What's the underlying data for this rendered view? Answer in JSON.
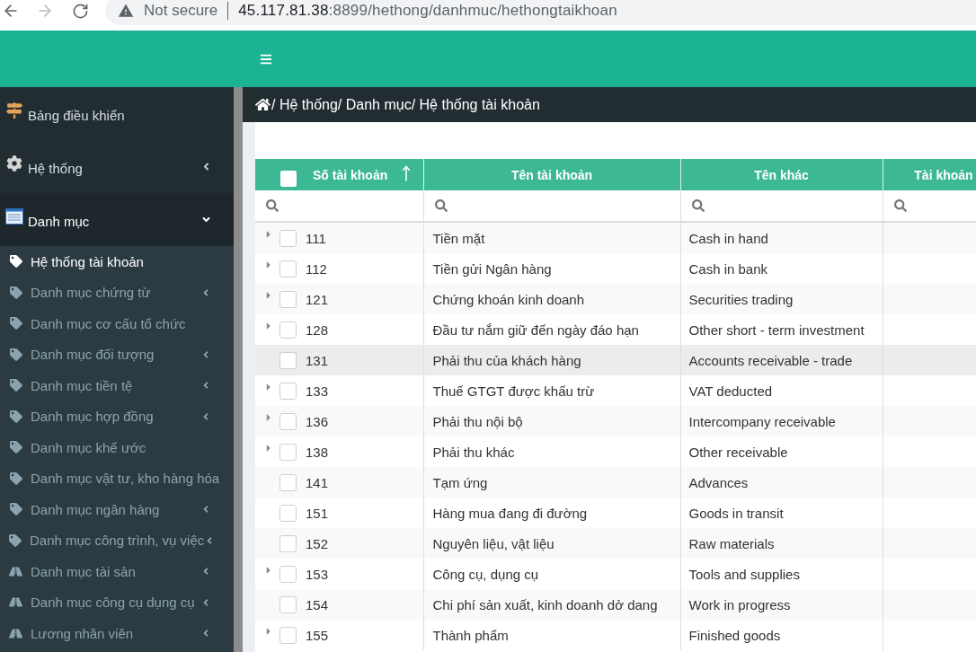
{
  "browser": {
    "security_label": "Not secure",
    "url_host": "45.117.81.38",
    "url_path": ":8899/hethong/danhmuc/hethongtaikhoan"
  },
  "sidebar": {
    "items": [
      {
        "label": "Bảng điều khiển",
        "kind": "dashboard",
        "expandable": false,
        "expanded": false
      },
      {
        "label": "Hệ thống",
        "kind": "system",
        "expandable": true,
        "expanded": false
      },
      {
        "label": "Danh mục",
        "kind": "catalog",
        "expandable": true,
        "expanded": true,
        "children": [
          {
            "label": "Hệ thống tài khoản",
            "kind": "tag",
            "expandable": false,
            "selected": true
          },
          {
            "label": "Danh mục chứng từ",
            "kind": "tag",
            "expandable": true,
            "selected": false
          },
          {
            "label": "Danh mục cơ cấu tổ chức",
            "kind": "tag",
            "expandable": false,
            "selected": false
          },
          {
            "label": "Danh mục đối tượng",
            "kind": "tag",
            "expandable": true,
            "selected": false
          },
          {
            "label": "Danh mục tiền tệ",
            "kind": "tag",
            "expandable": true,
            "selected": false
          },
          {
            "label": "Danh mục hợp đồng",
            "kind": "tag",
            "expandable": true,
            "selected": false
          },
          {
            "label": "Danh mục khế ước",
            "kind": "tag",
            "expandable": false,
            "selected": false
          },
          {
            "label": "Danh mục vật tư, kho hàng hóa",
            "kind": "tag",
            "expandable": false,
            "selected": false
          },
          {
            "label": "Danh mục ngân hàng",
            "kind": "tag",
            "expandable": true,
            "selected": false
          },
          {
            "label": "Danh mục công trình, vụ việc",
            "kind": "tag",
            "expandable": true,
            "selected": false
          },
          {
            "label": "Danh mục tài sản",
            "kind": "road",
            "expandable": true,
            "selected": false
          },
          {
            "label": "Danh mục công cụ dụng cụ",
            "kind": "road",
            "expandable": true,
            "selected": false
          },
          {
            "label": "Lương nhân viên",
            "kind": "road",
            "expandable": true,
            "selected": false
          }
        ]
      }
    ]
  },
  "breadcrumb": {
    "text": "/ Hệ thống/ Danh mục/ Hệ thống tài khoản"
  },
  "table": {
    "select_all": {
      "checked": false
    },
    "columns": [
      {
        "label": "Số tài khoản",
        "sorted": true
      },
      {
        "label": "Tên tài khoản",
        "sorted": false
      },
      {
        "label": "Tên khác",
        "sorted": false
      },
      {
        "label": "Tài khoản",
        "sorted": false
      }
    ],
    "rows": [
      {
        "account_no": "111",
        "name": "Tiền mặt",
        "other_name": "Cash in hand",
        "expandable": true,
        "checked": false,
        "highlighted": false
      },
      {
        "account_no": "112",
        "name": "Tiền gửi Ngân hàng",
        "other_name": "Cash in bank",
        "expandable": true,
        "checked": false,
        "highlighted": false
      },
      {
        "account_no": "121",
        "name": "Chứng khoán kinh doanh",
        "other_name": "Securities trading",
        "expandable": true,
        "checked": false,
        "highlighted": false
      },
      {
        "account_no": "128",
        "name": "Đầu tư nắm giữ đến ngày đáo hạn",
        "other_name": "Other short - term investment",
        "expandable": true,
        "checked": false,
        "highlighted": false
      },
      {
        "account_no": "131",
        "name": "Phải thu của khách hàng",
        "other_name": "Accounts receivable - trade",
        "expandable": false,
        "checked": false,
        "highlighted": true
      },
      {
        "account_no": "133",
        "name": "Thuế GTGT được khấu trừ",
        "other_name": "VAT deducted",
        "expandable": true,
        "checked": false,
        "highlighted": false
      },
      {
        "account_no": "136",
        "name": "Phải thu nội bộ",
        "other_name": "Intercompany receivable",
        "expandable": true,
        "checked": false,
        "highlighted": false
      },
      {
        "account_no": "138",
        "name": "Phải thu khác",
        "other_name": "Other receivable",
        "expandable": true,
        "checked": false,
        "highlighted": false
      },
      {
        "account_no": "141",
        "name": "Tạm ứng",
        "other_name": "Advances",
        "expandable": false,
        "checked": false,
        "highlighted": false
      },
      {
        "account_no": "151",
        "name": "Hàng mua đang đi đường",
        "other_name": "Goods in transit",
        "expandable": false,
        "checked": false,
        "highlighted": false
      },
      {
        "account_no": "152",
        "name": "Nguyên liệu, vật liệu",
        "other_name": "Raw materials",
        "expandable": false,
        "checked": false,
        "highlighted": false
      },
      {
        "account_no": "153",
        "name": "Công cụ, dụng cụ",
        "other_name": "Tools and supplies",
        "expandable": true,
        "checked": false,
        "highlighted": false
      },
      {
        "account_no": "154",
        "name": "Chi phí sản xuất, kinh doanh dở dang",
        "other_name": "Work in progress",
        "expandable": false,
        "checked": false,
        "highlighted": false
      },
      {
        "account_no": "155",
        "name": "Thành phẩm",
        "other_name": "Finished goods",
        "expandable": true,
        "checked": false,
        "highlighted": false
      }
    ]
  }
}
